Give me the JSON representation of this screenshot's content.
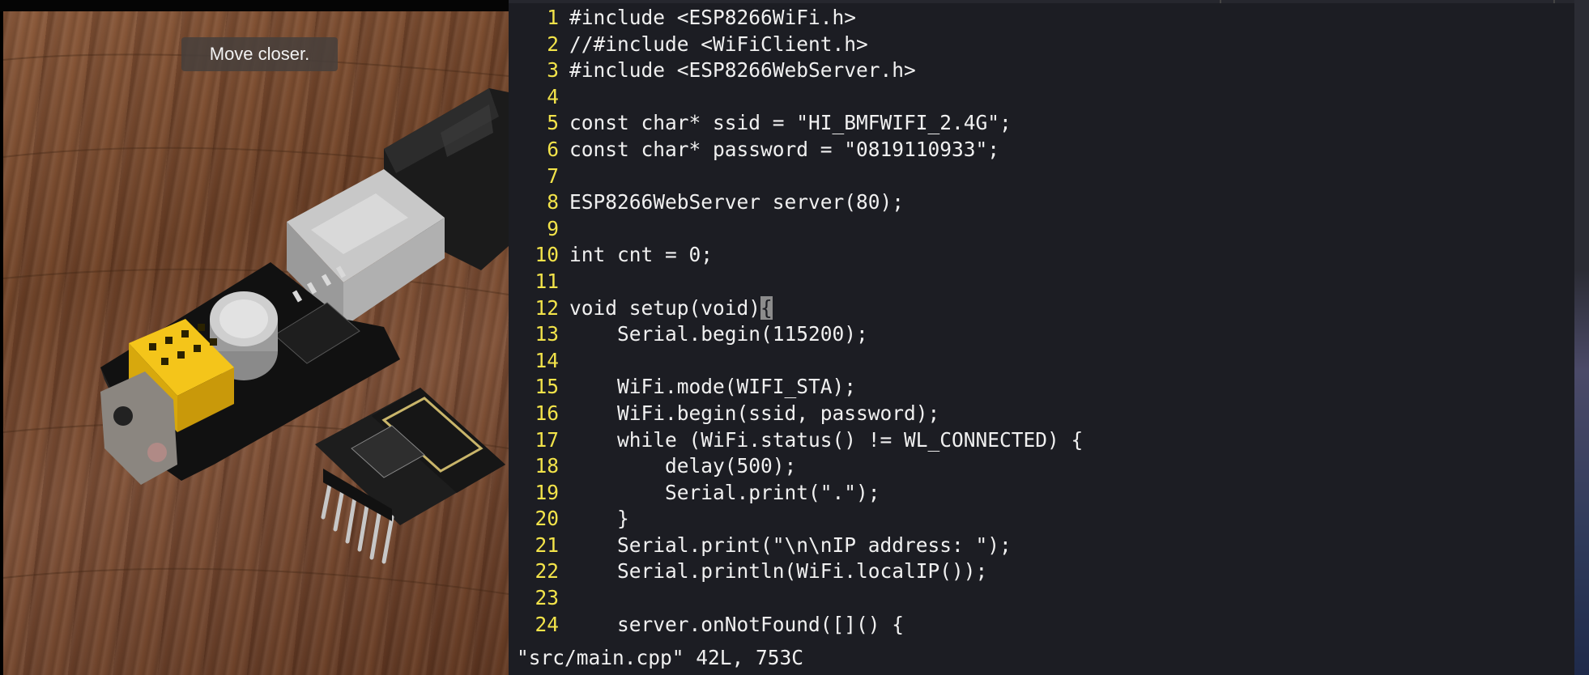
{
  "camera": {
    "toast": "Move closer."
  },
  "editor": {
    "lines": [
      {
        "n": "1",
        "code": "#include <ESP8266WiFi.h>"
      },
      {
        "n": "2",
        "code": "//#include <WiFiClient.h>"
      },
      {
        "n": "3",
        "code": "#include <ESP8266WebServer.h>"
      },
      {
        "n": "4",
        "code": ""
      },
      {
        "n": "5",
        "code": "const char* ssid = \"HI_BMFWIFI_2.4G\";"
      },
      {
        "n": "6",
        "code": "const char* password = \"0819110933\";"
      },
      {
        "n": "7",
        "code": ""
      },
      {
        "n": "8",
        "code": "ESP8266WebServer server(80);"
      },
      {
        "n": "9",
        "code": ""
      },
      {
        "n": "10",
        "code": "int cnt = 0;"
      },
      {
        "n": "11",
        "code": ""
      },
      {
        "n": "12",
        "code": "void setup(void)",
        "cursor_char": "{"
      },
      {
        "n": "13",
        "code": "    Serial.begin(115200);"
      },
      {
        "n": "14",
        "code": ""
      },
      {
        "n": "15",
        "code": "    WiFi.mode(WIFI_STA);"
      },
      {
        "n": "16",
        "code": "    WiFi.begin(ssid, password);"
      },
      {
        "n": "17",
        "code": "    while (WiFi.status() != WL_CONNECTED) {"
      },
      {
        "n": "18",
        "code": "        delay(500);"
      },
      {
        "n": "19",
        "code": "        Serial.print(\".\");"
      },
      {
        "n": "20",
        "code": "    }"
      },
      {
        "n": "21",
        "code": "    Serial.print(\"\\n\\nIP address: \");"
      },
      {
        "n": "22",
        "code": "    Serial.println(WiFi.localIP());"
      },
      {
        "n": "23",
        "code": ""
      },
      {
        "n": "24",
        "code": "    server.onNotFound([]() {"
      }
    ],
    "status": "\"src/main.cpp\" 42L, 753C"
  },
  "colors": {
    "editor_bg": "#1c1d23",
    "line_number": "#f2e34a",
    "code_text": "#f0f0f0",
    "cursor": "#8c8c8c",
    "wood": "#6e4329",
    "pcb": "#111111",
    "header_yellow": "#f4c51a"
  }
}
